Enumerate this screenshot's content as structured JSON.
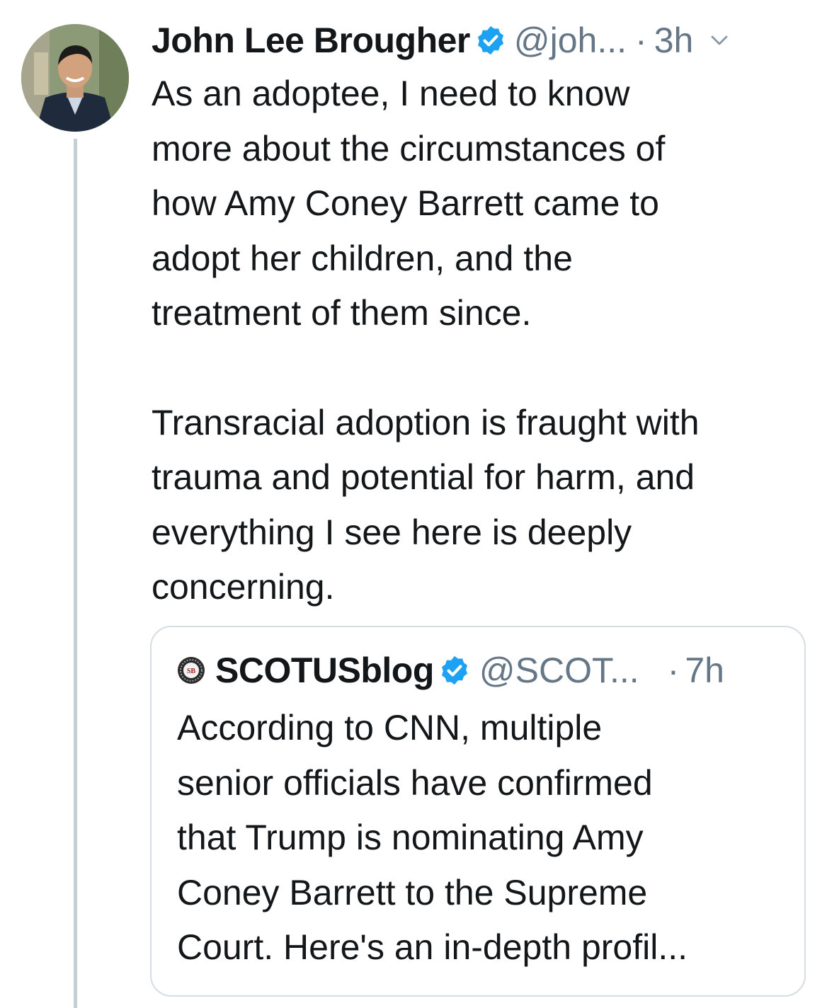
{
  "tweet": {
    "author_name": "John Lee Brougher",
    "handle": "@joh...",
    "separator": "·",
    "time": "3h",
    "body_lines_1": [
      "As an adoptee, I need to know",
      "more about the circumstances of",
      "how Amy Coney Barrett came to",
      "adopt her children, and the",
      "treatment of them since."
    ],
    "body_lines_2": [
      "Transracial adoption is fraught with",
      "trauma and potential for harm, and",
      "everything I see here is deeply",
      "concerning."
    ],
    "icons": {
      "avatar": "profile-photo",
      "verified": "verified-badge-icon",
      "menu": "chevron-down-icon"
    }
  },
  "quoted_tweet": {
    "author_name": "SCOTUSblog",
    "avatar_text": "SB",
    "handle": "@SCOT...",
    "separator": "·",
    "time": "7h",
    "body_lines": [
      "According to CNN, multiple",
      "senior officials have confirmed",
      "that Trump is nominating Amy",
      "Coney Barrett to the Supreme",
      "Court. Here's an in-depth profil..."
    ]
  },
  "colors": {
    "text_primary": "#14171a",
    "text_secondary": "#657786",
    "verified_blue": "#1da1f2",
    "border": "#d6dde3",
    "thread_line": "#c4cfd6"
  }
}
